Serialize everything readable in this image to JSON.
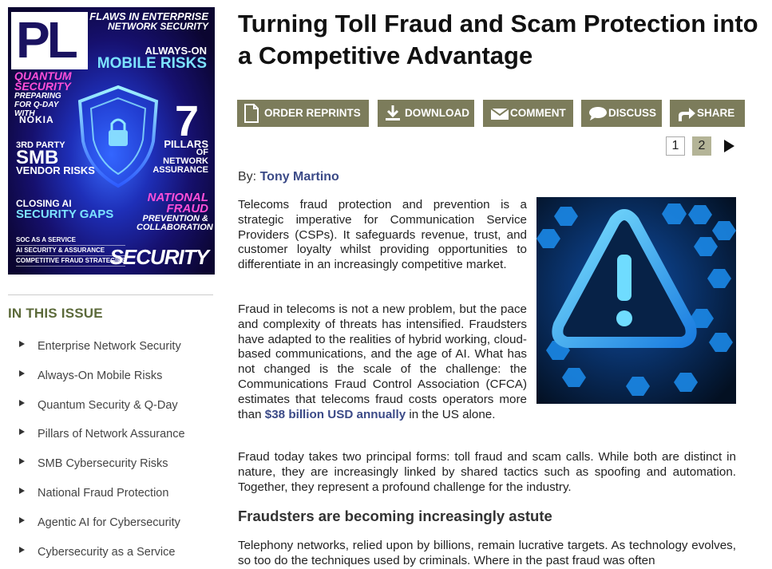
{
  "cover": {
    "logo": "PL",
    "headline_top_1": "FLAWS IN ENTERPRISE",
    "headline_top_2": "NETWORK SECURITY",
    "always_on": "ALWAYS-ON",
    "mobile_risks": "MOBILE RISKS",
    "quantum_security": "QUANTUM SECURITY",
    "preparing": "PREPARING FOR Q-DAY WITH",
    "nokia": "NOKIA",
    "third_party": "3RD PARTY",
    "smb": "SMB",
    "vendor_risks": "VENDOR RISKS",
    "seven": "7",
    "pillars": "PILLARS",
    "pillars_sub": "OF NETWORK ASSURANCE",
    "closing_ai": "CLOSING AI",
    "security_gaps": "SECURITY GAPS",
    "national": "NATIONAL FRAUD",
    "national_sub": "PREVENTION & COLLABORATION",
    "toc_1": "SOC AS A SERVICE",
    "toc_2": "AI SECURITY & ASSURANCE",
    "toc_3": "COMPETITIVE FRAUD STRATEGIES",
    "security_word": "SECURITY"
  },
  "sidebar": {
    "title": "IN THIS ISSUE",
    "items": [
      "Enterprise Network Security",
      "Always-On Mobile Risks",
      "Quantum Security & Q-Day",
      "Pillars of Network Assurance",
      "SMB Cybersecurity Risks",
      "National Fraud Protection",
      "Agentic AI for Cybersecurity",
      "Cybersecurity as a Service"
    ]
  },
  "article": {
    "title": "Turning Toll Fraud and Scam Protection into a Competitive Advantage",
    "toolbar": {
      "reprints": "ORDER REPRINTS",
      "download": "DOWNLOAD",
      "comment": "COMMENT",
      "discuss": "DISCUSS",
      "share": "SHARE"
    },
    "pager": {
      "page1": "1",
      "page2": "2"
    },
    "byline_prefix": "By:",
    "author": "Tony Martino",
    "p1": "Telecoms fraud protection and prevention is a strategic imperative for Communication Service Providers (CSPs). It safeguards revenue, trust, and customer loyalty whilst providing opportunities to differentiate in an increasingly competitive market.",
    "p2_a": "Fraud in telecoms is not a new problem, but the pace and complexity of threats has intensified. Fraudsters have adapted to the realities of hybrid working, cloud-based communications, and the age of AI. What has not changed is the scale of the challenge: the Communications Fraud Control Association (CFCA) estimates that telecoms fraud costs operators more than ",
    "p2_highlight": "$38 billion USD annually",
    "p2_b": " in the US alone.",
    "p3": "Fraud today takes two principal forms: toll fraud and scam calls. While both are distinct in nature, they are increasingly linked by shared tactics such as spoofing and automation. Together, they represent a profound challenge for the industry.",
    "h2": "Fraudsters are becoming increasingly astute",
    "p4": "Telephony networks, relied upon by billions, remain lucrative targets. As technology evolves, so too do the techniques used by criminals. Where in the past fraud was often"
  },
  "colors": {
    "toolbar_bg": "#7c7c5b",
    "sidebar_title": "#5c6a3a",
    "link": "#3b4a87",
    "active_page": "#b4b497"
  },
  "icons": [
    "document-icon",
    "download-icon",
    "envelope-icon",
    "speech-bubble-icon",
    "share-arrow-icon",
    "next-arrow-icon",
    "warning-triangle-icon"
  ]
}
